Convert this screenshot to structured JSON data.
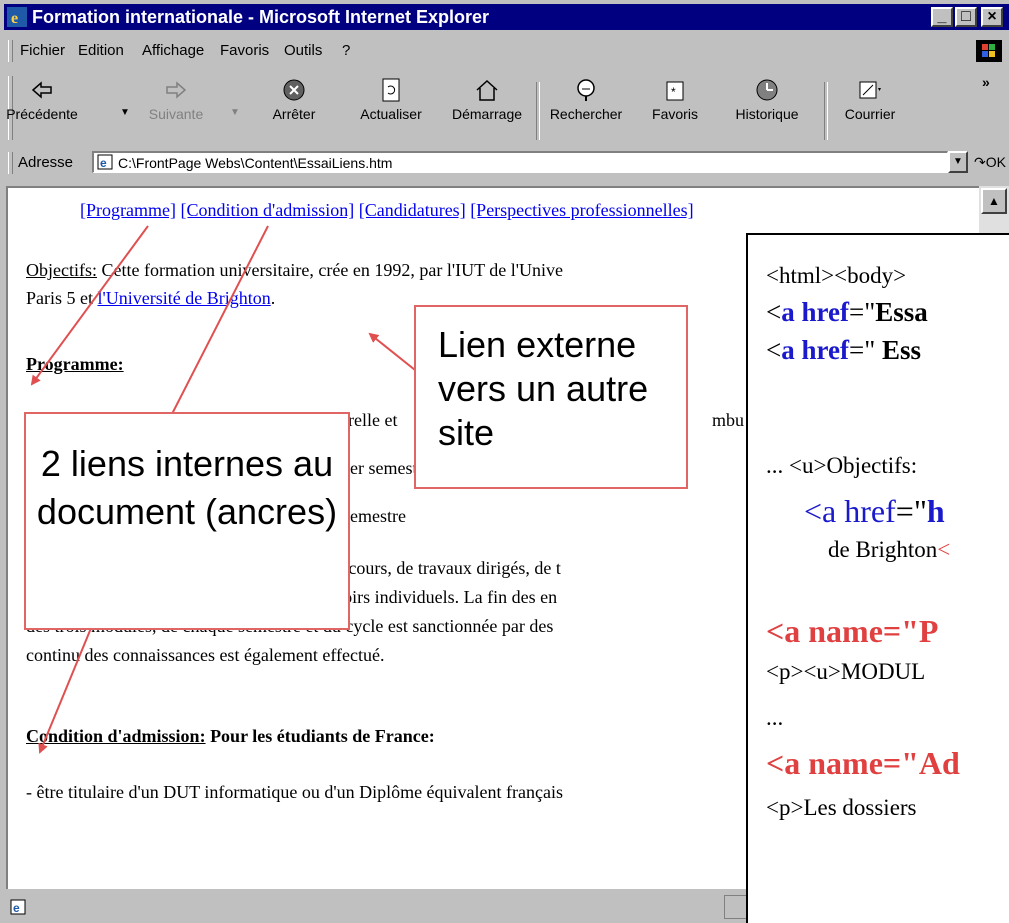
{
  "window": {
    "title": "Formation internationale - Microsoft Internet Explorer",
    "controls": [
      "_",
      "□",
      "×"
    ]
  },
  "menu": [
    "Fichier",
    "Edition",
    "Affichage",
    "Favoris",
    "Outils",
    "?"
  ],
  "toolbar": [
    {
      "label": "Précédente",
      "icon": "back-arrow-icon",
      "enabled": true
    },
    {
      "label": "Suivante",
      "icon": "forward-arrow-icon",
      "enabled": false
    },
    {
      "label": "Arrêter",
      "icon": "stop-icon",
      "enabled": true
    },
    {
      "label": "Actualiser",
      "icon": "refresh-icon",
      "enabled": true
    },
    {
      "label": "Démarrage",
      "icon": "home-icon",
      "enabled": true
    },
    {
      "label": "Rechercher",
      "icon": "search-icon",
      "enabled": true
    },
    {
      "label": "Favoris",
      "icon": "favorites-icon",
      "enabled": true
    },
    {
      "label": "Historique",
      "icon": "history-icon",
      "enabled": true
    },
    {
      "label": "Courrier",
      "icon": "mail-icon",
      "enabled": true
    }
  ],
  "toolbar_more": "»",
  "address": {
    "label": "Adresse",
    "value": "C:\\FrontPage Webs\\Content\\EssaiLiens.htm",
    "go_label": "OK"
  },
  "page": {
    "nav_links": [
      "[Programme]",
      "[Condition d'admission]",
      "[Candidatures]",
      "[Perspectives professionnelles]"
    ],
    "objectifs_label": "Objectifs:",
    "objectifs_text": " Cette formation universitaire, crée en 1992, par l'IUT de l'Unive",
    "paris_text": "Paris 5 et ",
    "brighton_link": "l'Université de Brighton",
    "brighton_after": ".",
    "programme_heading": "Programme:",
    "line_a": "relle et",
    "line_a2": "mbu",
    "line_b": "er semestre",
    "line_c": "emestre",
    "para": [
      "Cette formation est dispensée sous forme de cours, de travaux dirigés, de t",
      "personnelles, d'exposés, de projets et de devoirs individuels. La fin des en",
      "des trois modules, de chaque semestre et du cycle est sanctionnée par des",
      "continu des connaissances est également effectué."
    ],
    "admission_heading": "Condition d'admission:",
    "admission_after": " Pour les étudiants de France:",
    "last_line": "- être titulaire d'un DUT informatique ou d'un Diplôme équivalent français"
  },
  "callouts": {
    "external": "Lien externe vers un autre site",
    "internal": "2 liens internes au document (ancres)"
  },
  "code_panel": {
    "l1": "<html><body>",
    "l2_a": "<",
    "l2_kw": "a href",
    "l2_b": "=\"",
    "l2_c": "Essa",
    "l3_a": "<",
    "l3_kw": "a href",
    "l3_b": "=\" ",
    "l3_c": "Ess",
    "l4": "... <u>Objectifs:",
    "l5_a": "<",
    "l5_kw": "a href",
    "l5_b": "=\"",
    "l5_c": "h",
    "l6": "de Brighton",
    "l6_tail": "<",
    "l7": "<a name=\"P",
    "l8": "<p><u>MODUL",
    "l9": "...",
    "l10": "<a name=\"Ad",
    "l11": "<p>Les dossiers"
  },
  "colors": {
    "titlebar": "#000080",
    "link": "#0000ee",
    "callout_border": "#e06666",
    "arrow": "#e05050",
    "code_keyword": "#1a1acc",
    "code_anchor": "#e04040"
  }
}
